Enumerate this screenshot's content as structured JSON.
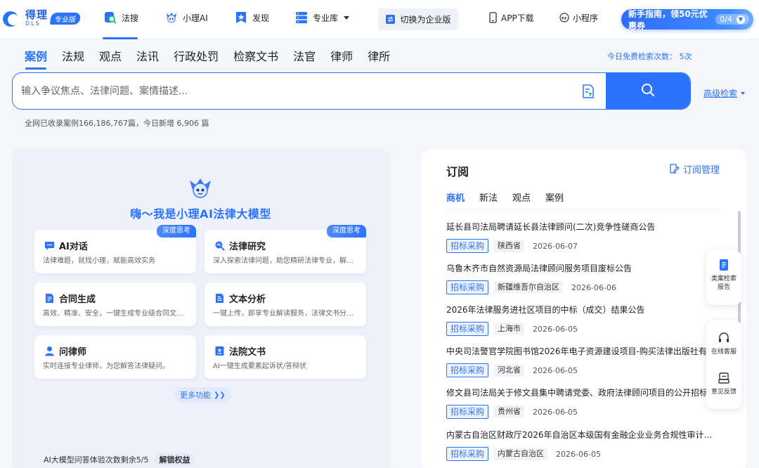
{
  "topnav": {
    "logo_cn": "得理",
    "logo_en": "DLS",
    "pro_badge": "专业版",
    "items": [
      {
        "label": "法搜",
        "icon": "search-doc-icon"
      },
      {
        "label": "小理AI",
        "icon": "robot-mascot-icon"
      },
      {
        "label": "发现",
        "icon": "star-bookmark-icon"
      },
      {
        "label": "专业库",
        "icon": "database-icon"
      },
      {
        "label": "APP下载",
        "icon": "phone-icon"
      },
      {
        "label": "小程序",
        "icon": "mini-program-icon"
      }
    ],
    "switch_enterprise": "切换为企业版",
    "guide": {
      "label": "新手指南，领50元优惠券",
      "count": "0/4"
    }
  },
  "search": {
    "tabs": [
      "案例",
      "法规",
      "观点",
      "法讯",
      "行政处罚",
      "检察文书",
      "法官",
      "律师",
      "律所"
    ],
    "active_tab": "案例",
    "free_count": "今日免费检索次数： 5次",
    "placeholder": "输入争议焦点、法律问题、案情描述...",
    "value": "",
    "advanced": "高级检索",
    "stats": "全网已收录案例166,186,767篇，今日新增 6,906 篇"
  },
  "ai_panel": {
    "title": "嗨～我是小理AI法律大模型",
    "cards": [
      {
        "title": "AI对话",
        "desc": "法律难题，就找小理，赋能高效实务",
        "badge": "深度思考",
        "icon": "chat-icon"
      },
      {
        "title": "法律研究",
        "desc": "深入探索法律问题，助您精研法律专业，解…",
        "badge": "深度思考",
        "icon": "research-icon"
      },
      {
        "title": "合同生成",
        "desc": "高效、精准、安全，一键生成专业级合同文…",
        "badge": "",
        "icon": "contract-icon"
      },
      {
        "title": "文本分析",
        "desc": "一键上传，即享专业解读服务，法律文书分…",
        "badge": "",
        "icon": "text-analysis-icon"
      },
      {
        "title": "问律师",
        "desc": "实时连接专业律师，为您解答法律疑问。",
        "badge": "",
        "icon": "lawyer-icon"
      },
      {
        "title": "法院文书",
        "desc": "AI一键生成要素起诉状/答辩状",
        "badge": "",
        "icon": "court-doc-icon"
      }
    ],
    "more": "更多功能",
    "quota": "AI大模型问答体验次数剩余5/5",
    "unlock": "解锁权益"
  },
  "subscription": {
    "title": "订阅",
    "manage": "订阅管理",
    "tabs": [
      "商机",
      "新法",
      "观点",
      "案例"
    ],
    "active_tab": "商机",
    "items": [
      {
        "title": "延长县司法局聘请延长县法律顾问(二次)竞争性磋商公告",
        "type": "招标采购",
        "region": "陕西省",
        "date": "2026-06-07"
      },
      {
        "title": "乌鲁木齐市自然资源局法律顾问服务项目废标公告",
        "type": "招标采购",
        "region": "新疆维吾尔自治区",
        "date": "2026-06-06"
      },
      {
        "title": "2026年法律服务进社区项目的中标（成交）结果公告",
        "type": "招标采购",
        "region": "上海市",
        "date": "2026-06-05"
      },
      {
        "title": "中央司法警官学院图书馆2026年电子资源建设项目-购买法律出版社有",
        "type": "招标采购",
        "region": "河北省",
        "date": "2026-06-05"
      },
      {
        "title": "修文县司法局关于修文县集中聘请党委、政府法律顾问项目的公开招标",
        "type": "招标采购",
        "region": "贵州省",
        "date": "2026-06-05"
      },
      {
        "title": "内蒙古自治区财政厅2026年自治区本级国有金融企业业务合规性审计中…",
        "type": "招标采购",
        "region": "内蒙古自治区",
        "date": "2026-06-05"
      }
    ]
  },
  "float": {
    "report": "类案检索报告",
    "service": "在线客服",
    "feedback": "意见反馈"
  }
}
